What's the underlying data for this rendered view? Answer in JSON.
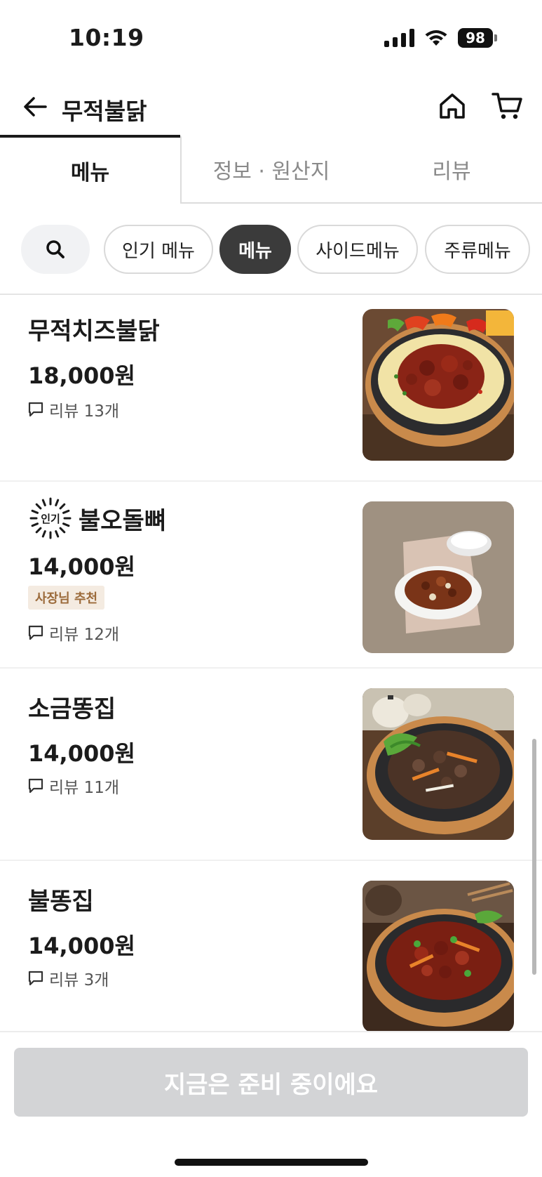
{
  "status": {
    "time": "10:19",
    "battery": "98"
  },
  "header": {
    "title": "무적불닭"
  },
  "tabs": [
    {
      "label": "메뉴",
      "selected": true
    },
    {
      "label": "정보 · 원산지",
      "selected": false
    },
    {
      "label": "리뷰",
      "selected": false
    }
  ],
  "chips": [
    {
      "label": "인기 메뉴",
      "selected": false
    },
    {
      "label": "메뉴",
      "selected": true
    },
    {
      "label": "사이드메뉴",
      "selected": false
    },
    {
      "label": "주류메뉴",
      "selected": false
    }
  ],
  "menu": [
    {
      "name": "무적치즈불닭",
      "price": "18,000원",
      "review": "리뷰 13개"
    },
    {
      "name": "불오돌뼈",
      "popular_label": "인기",
      "price": "14,000원",
      "badge": "사장님 추천",
      "review": "리뷰 12개"
    },
    {
      "name": "소금똥집",
      "price": "14,000원",
      "review": "리뷰 11개"
    },
    {
      "name": "불똥집",
      "price": "14,000원",
      "review": "리뷰 3개"
    }
  ],
  "footer": {
    "button_label": "지금은 준비 중이에요"
  },
  "colors": {
    "selected_chip": "#3b3b3b",
    "disabled_button": "#d3d4d6",
    "badge_bg": "#f4ebe1",
    "badge_text": "#9b6a3a"
  },
  "icons": [
    "back-arrow-icon",
    "home-icon",
    "cart-icon",
    "search-icon",
    "review-bubble-icon",
    "popular-burst-icon"
  ]
}
